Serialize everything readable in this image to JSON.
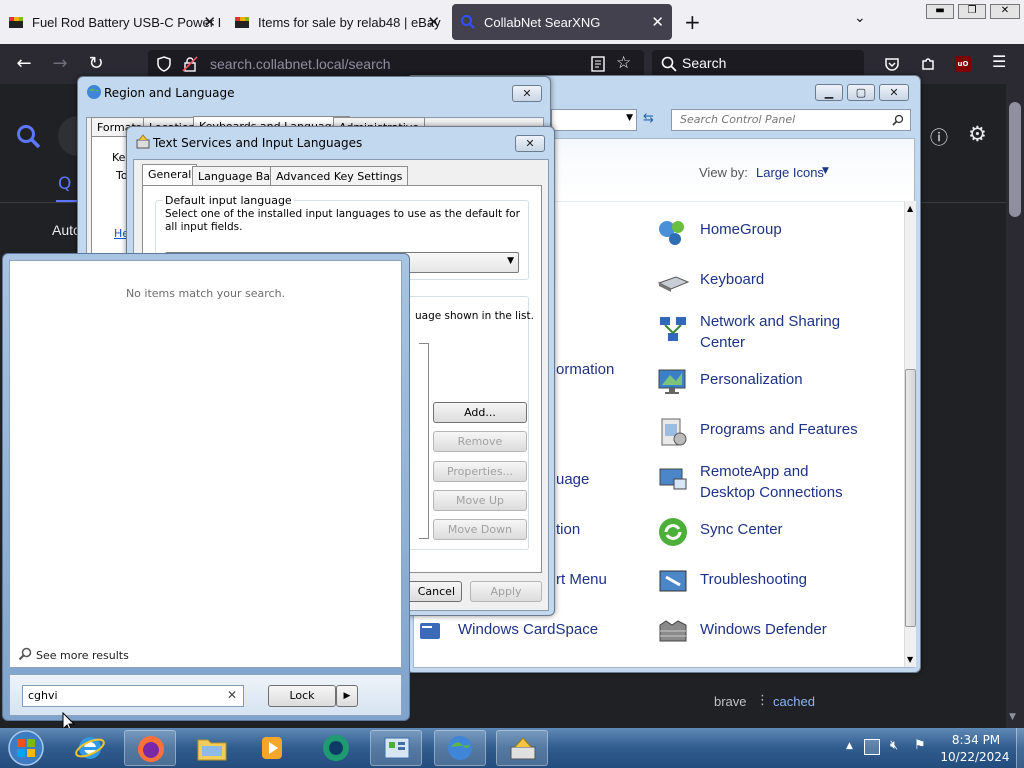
{
  "browser": {
    "tabs": [
      {
        "title": "Fuel Rod Battery USB-C Power I"
      },
      {
        "title": "Items for sale by relab48 | eBay"
      },
      {
        "title": "CollabNet SearXNG"
      }
    ],
    "url": "search.collabnet.local/search",
    "search_placeholder": "Search"
  },
  "page_behind": {
    "partial_tab": "Auto",
    "footer_engine": "brave",
    "footer_cached": "cached"
  },
  "region_dialog": {
    "title": "Region and Language",
    "tabs": [
      "Formats",
      "Location",
      "Keyboards and Languages",
      "Administrative"
    ],
    "partial_ke": "Ke",
    "partial_to": "To",
    "partial_he": "He"
  },
  "text_services_dialog": {
    "title": "Text Services and Input Languages",
    "tabs": [
      "General",
      "Language Bar",
      "Advanced Key Settings"
    ],
    "group_title": "Default input language",
    "group_desc": "Select one of the installed input languages to use as the default for all input fields.",
    "installed_desc_partial": "uage shown in the list.",
    "buttons": {
      "add": "Add...",
      "remove": "Remove",
      "properties": "Properties...",
      "move_up": "Move Up",
      "move_down": "Move Down",
      "cancel": "Cancel",
      "apply": "Apply"
    }
  },
  "control_panel": {
    "search_placeholder": "Search Control Panel",
    "view_by_label": "View by:",
    "view_by_value": "Large Icons",
    "left_partial": [
      {
        "text": "ormation"
      },
      {
        "text": "uage"
      },
      {
        "text": "tion"
      },
      {
        "text": "rt Menu"
      },
      {
        "text": "Windows CardSpace"
      }
    ],
    "items": [
      {
        "label": "HomeGroup",
        "icon": "homegroup-icon"
      },
      {
        "label": "Keyboard",
        "icon": "keyboard-icon"
      },
      {
        "label": "Network and Sharing Center",
        "icon": "network-icon"
      },
      {
        "label": "Personalization",
        "icon": "personalization-icon"
      },
      {
        "label": "Programs and Features",
        "icon": "programs-icon"
      },
      {
        "label": "RemoteApp and Desktop Connections",
        "icon": "remoteapp-icon"
      },
      {
        "label": "Sync Center",
        "icon": "sync-icon"
      },
      {
        "label": "Troubleshooting",
        "icon": "troubleshooting-icon"
      },
      {
        "label": "Windows Defender",
        "icon": "defender-icon"
      }
    ]
  },
  "start_menu": {
    "no_items": "No items match your search.",
    "see_more": "See more results",
    "search_value": "cghvi",
    "lock_label": "Lock"
  },
  "taskbar": {
    "time": "8:34 PM",
    "date": "10/22/2024"
  }
}
